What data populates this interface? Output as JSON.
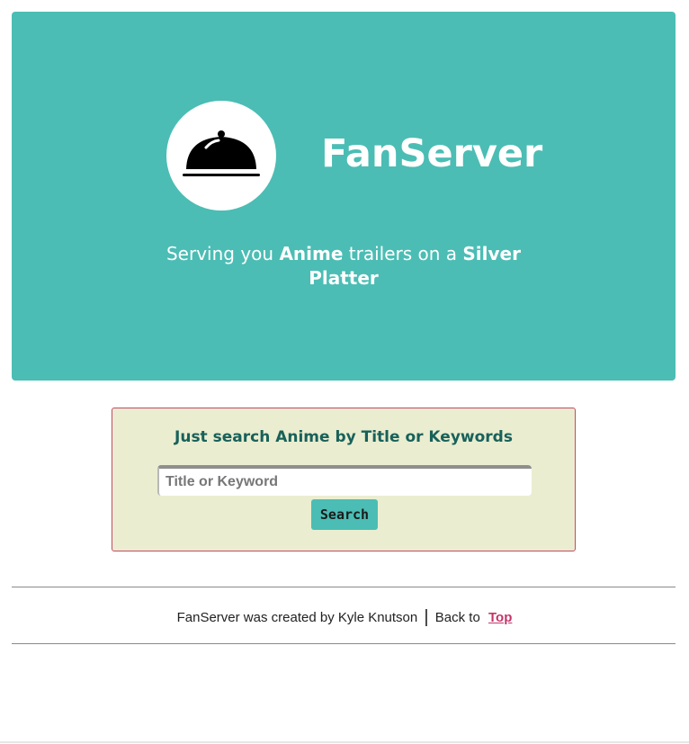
{
  "hero": {
    "brand": "FanServer",
    "logo_icon": "cloche-icon",
    "tagline_part1": "Serving you ",
    "tagline_anime": "Anime",
    "tagline_part2": " trailers on a ",
    "tagline_silver": "Silver Platter",
    "background_color": "#4bbdb4"
  },
  "search": {
    "heading": "Just search Anime by Title or Keywords",
    "placeholder": "Title or Keyword",
    "value": "",
    "button_label": "Search",
    "card_color": "#eaedd0",
    "border_color": "#c7486a"
  },
  "footer": {
    "credit": "FanServer was created by Kyle Knutson",
    "separator": "|",
    "back_to": "Back to",
    "top_link": "Top",
    "link_color": "#c4356a"
  }
}
